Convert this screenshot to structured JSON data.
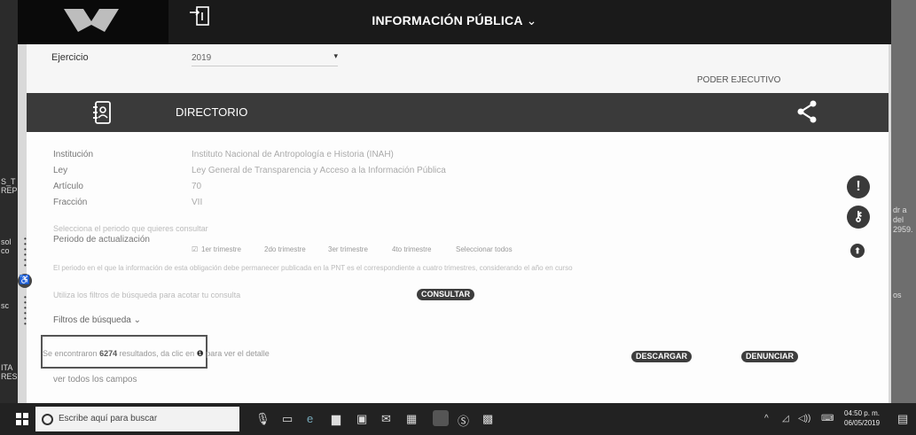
{
  "portal": {
    "title": "INFORMACIÓN PÚBLICA",
    "title_chevron": "⌄"
  },
  "ejercicio": {
    "label": "Ejercicio",
    "value": "2019"
  },
  "poder": "PODER EJECUTIVO",
  "directorio": {
    "title": "DIRECTORIO"
  },
  "details": [
    {
      "label": "Institución",
      "value": "Instituto Nacional de Antropología e Historia (INAH)"
    },
    {
      "label": "Ley",
      "value": "Ley General de Transparencia y Acceso a la Información Pública"
    },
    {
      "label": "Artículo",
      "value": "70"
    },
    {
      "label": "Fracción",
      "value": "VII"
    }
  ],
  "periodo": {
    "prompt": "Selecciona el periodo que quieres consultar",
    "label": "Periodo de actualización",
    "options": [
      "1er trimestre",
      "2do trimestre",
      "3er trimestre",
      "4to trimestre",
      "Seleccionar todos"
    ]
  },
  "notes": {
    "permanencia": "El periodo en el que la información de esta obligación debe permanecer publicada en la PNT es el correspondiente a cuatro trimestres, considerando el año en curso",
    "filtros_hint": "Utiliza los filtros de búsqueda para acotar tu consulta"
  },
  "buttons": {
    "consultar": "CONSULTAR",
    "descargar": "DESCARGAR",
    "denunciar": "DENUNCIAR"
  },
  "filtros": {
    "label": "Filtros de búsqueda",
    "chevron": "⌄"
  },
  "results": {
    "prefix": "Se encontraron",
    "count": "6274",
    "suffix": "resultados, da clic en",
    "tail": "para ver el detalle",
    "info_glyph": "❶",
    "ver_todos": "ver todos los campos"
  },
  "side_icons": {
    "alert": "!",
    "key": "⚷",
    "arrow": "⬆"
  },
  "accessibility_glyph": "♿",
  "edge_text": {
    "left": [
      "S_T",
      "REP",
      "sol",
      "co",
      "sc",
      "ITA",
      "RES"
    ],
    "right": [
      "dr a",
      "del",
      "2959.",
      "os"
    ]
  },
  "taskbar": {
    "search_placeholder": "Escribe aquí para buscar",
    "time": "04:50 p. m.",
    "date": "06/05/2019",
    "icons": [
      "mic",
      "task-view",
      "edge",
      "file-explorer",
      "store",
      "mail",
      "calendar",
      "chrome",
      "skype",
      "app"
    ]
  },
  "colors": {
    "header": "#3a3a3a",
    "topbar": "#1a1a1a",
    "button": "#3d3d3d"
  }
}
